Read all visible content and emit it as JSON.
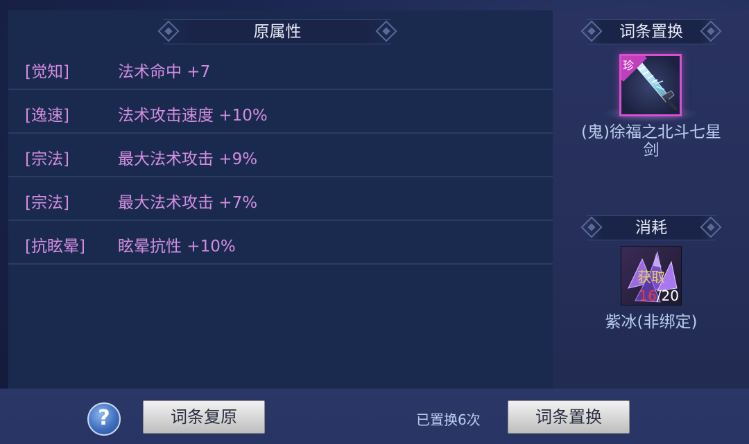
{
  "original_attributes": {
    "title": "原属性",
    "rows": [
      {
        "tag": "[觉知]",
        "text": "法术命中 +7"
      },
      {
        "tag": "[逸速]",
        "text": "法术攻击速度 +10%"
      },
      {
        "tag": "[宗法]",
        "text": "最大法术攻击 +9%"
      },
      {
        "tag": "[宗法]",
        "text": "最大法术攻击 +7%"
      },
      {
        "tag": "[抗眩晕]",
        "text": "眩晕抗性 +10%"
      }
    ]
  },
  "side": {
    "replace_title": "词条置换",
    "weapon": {
      "rarity": "珍",
      "name_line1": "(鬼)徐福之北斗七星",
      "name_line2": "剑",
      "icon": "sword-icon",
      "frame_color": "#d84fd0"
    },
    "cost_title": "消耗",
    "material": {
      "obtain_label": "获取",
      "have": "16",
      "separator": "/",
      "need": "20",
      "name": "紫冰(非绑定)",
      "icon": "purple-crystal-icon"
    }
  },
  "footer": {
    "help_symbol": "?",
    "restore_button": "词条复原",
    "replaced_count": "已置换6次",
    "replace_button": "词条置换"
  },
  "colors": {
    "attribute_text": "#d48de0",
    "item_name": "#b9cdee",
    "count_have": "#e33d3d",
    "obtain_label": "#e3d454"
  }
}
